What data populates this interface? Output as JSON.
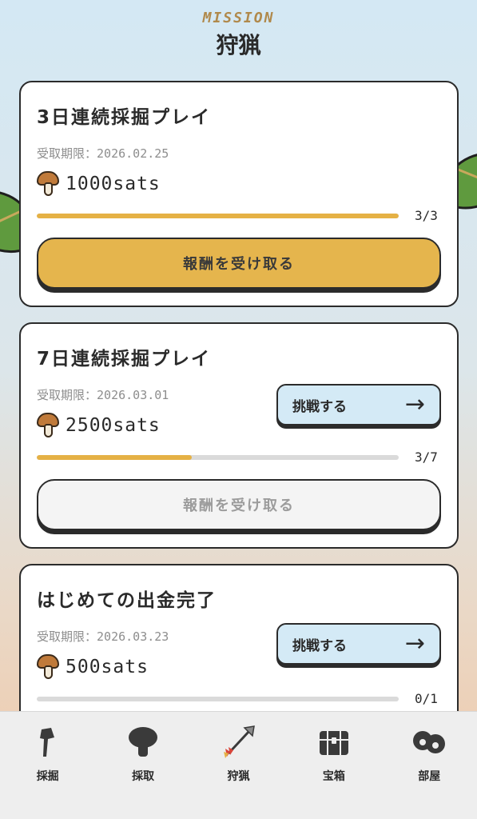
{
  "header": {
    "mission_label": "MISSION",
    "title": "狩猟"
  },
  "missions": [
    {
      "title": "3日連続採掘プレイ",
      "deadline_label": "受取期限：",
      "deadline_date": "2026.02.25",
      "reward": "1000sats",
      "progress_text": "3/3",
      "progress": 1.0,
      "claim_label": "報酬を受け取る",
      "claim_state": "active"
    },
    {
      "title": "7日連続採掘プレイ",
      "deadline_label": "受取期限：",
      "deadline_date": "2026.03.01",
      "reward": "2500sats",
      "progress_text": "3/7",
      "progress": 0.4286,
      "challenge_label": "挑戦する",
      "claim_label": "報酬を受け取る",
      "claim_state": "disabled"
    },
    {
      "title": "はじめての出金完了",
      "deadline_label": "受取期限：",
      "deadline_date": "2026.03.23",
      "reward": "500sats",
      "progress_text": "0/1",
      "progress": 0.0,
      "challenge_label": "挑戦する"
    }
  ],
  "nav": [
    {
      "label": "採掘",
      "icon": "axe-icon"
    },
    {
      "label": "採取",
      "icon": "mushroom-icon"
    },
    {
      "label": "狩猟",
      "icon": "arrow-icon"
    },
    {
      "label": "宝箱",
      "icon": "treasure-chest-icon"
    },
    {
      "label": "部屋",
      "icon": "room-icon"
    }
  ],
  "colors": {
    "accent": "#e5b145",
    "challenge_bg": "#d4eaf6",
    "nav_bg": "#eeeeee"
  }
}
